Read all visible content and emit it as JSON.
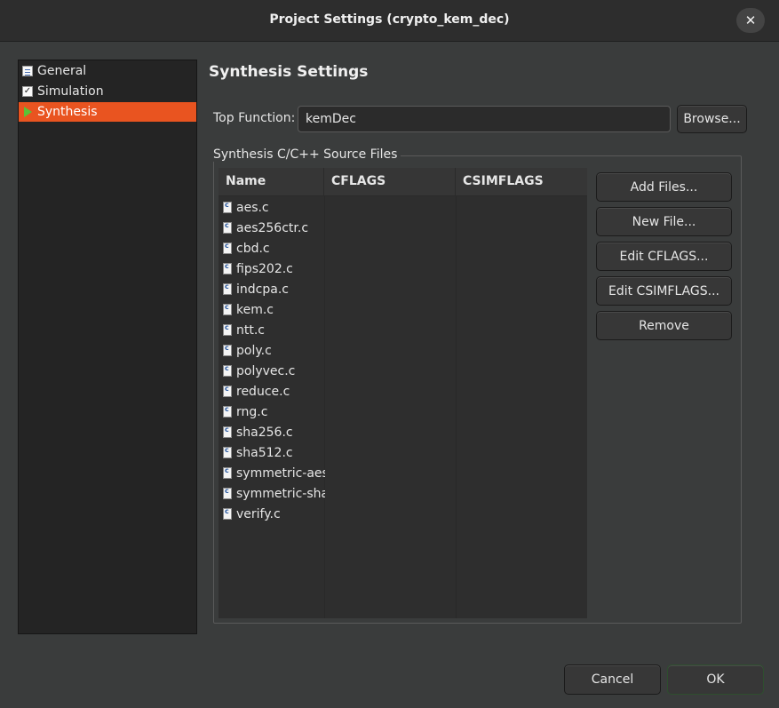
{
  "window": {
    "title": "Project Settings (crypto_kem_dec)",
    "close_glyph": "✕"
  },
  "nav": {
    "items": [
      {
        "label": "General",
        "icon": "general-settings-icon"
      },
      {
        "label": "Simulation",
        "icon": "checkbox-icon"
      },
      {
        "label": "Synthesis",
        "icon": "play-icon",
        "selected": true
      }
    ]
  },
  "synthesis": {
    "section_title": "Synthesis Settings",
    "top_function_label": "Top Function:",
    "top_function_value": "kemDec",
    "browse_label": "Browse...",
    "group_label": "Synthesis C/C++ Source Files",
    "table": {
      "headers": [
        "Name",
        "CFLAGS",
        "CSIMFLAGS"
      ],
      "files": [
        "aes.c",
        "aes256ctr.c",
        "cbd.c",
        "fips202.c",
        "indcpa.c",
        "kem.c",
        "ntt.c",
        "poly.c",
        "polyvec.c",
        "reduce.c",
        "rng.c",
        "sha256.c",
        "sha512.c",
        "symmetric-aes",
        "symmetric-sha",
        "verify.c"
      ]
    },
    "buttons": {
      "add_files": "Add Files...",
      "new_file": "New File...",
      "edit_cflags": "Edit CFLAGS...",
      "edit_csimflags": "Edit CSIMFLAGS...",
      "remove": "Remove"
    }
  },
  "footer": {
    "cancel": "Cancel",
    "ok": "OK"
  },
  "colors": {
    "accent": "#e95420",
    "background": "#3a3c3c",
    "titlebar": "#2d2d2d"
  }
}
